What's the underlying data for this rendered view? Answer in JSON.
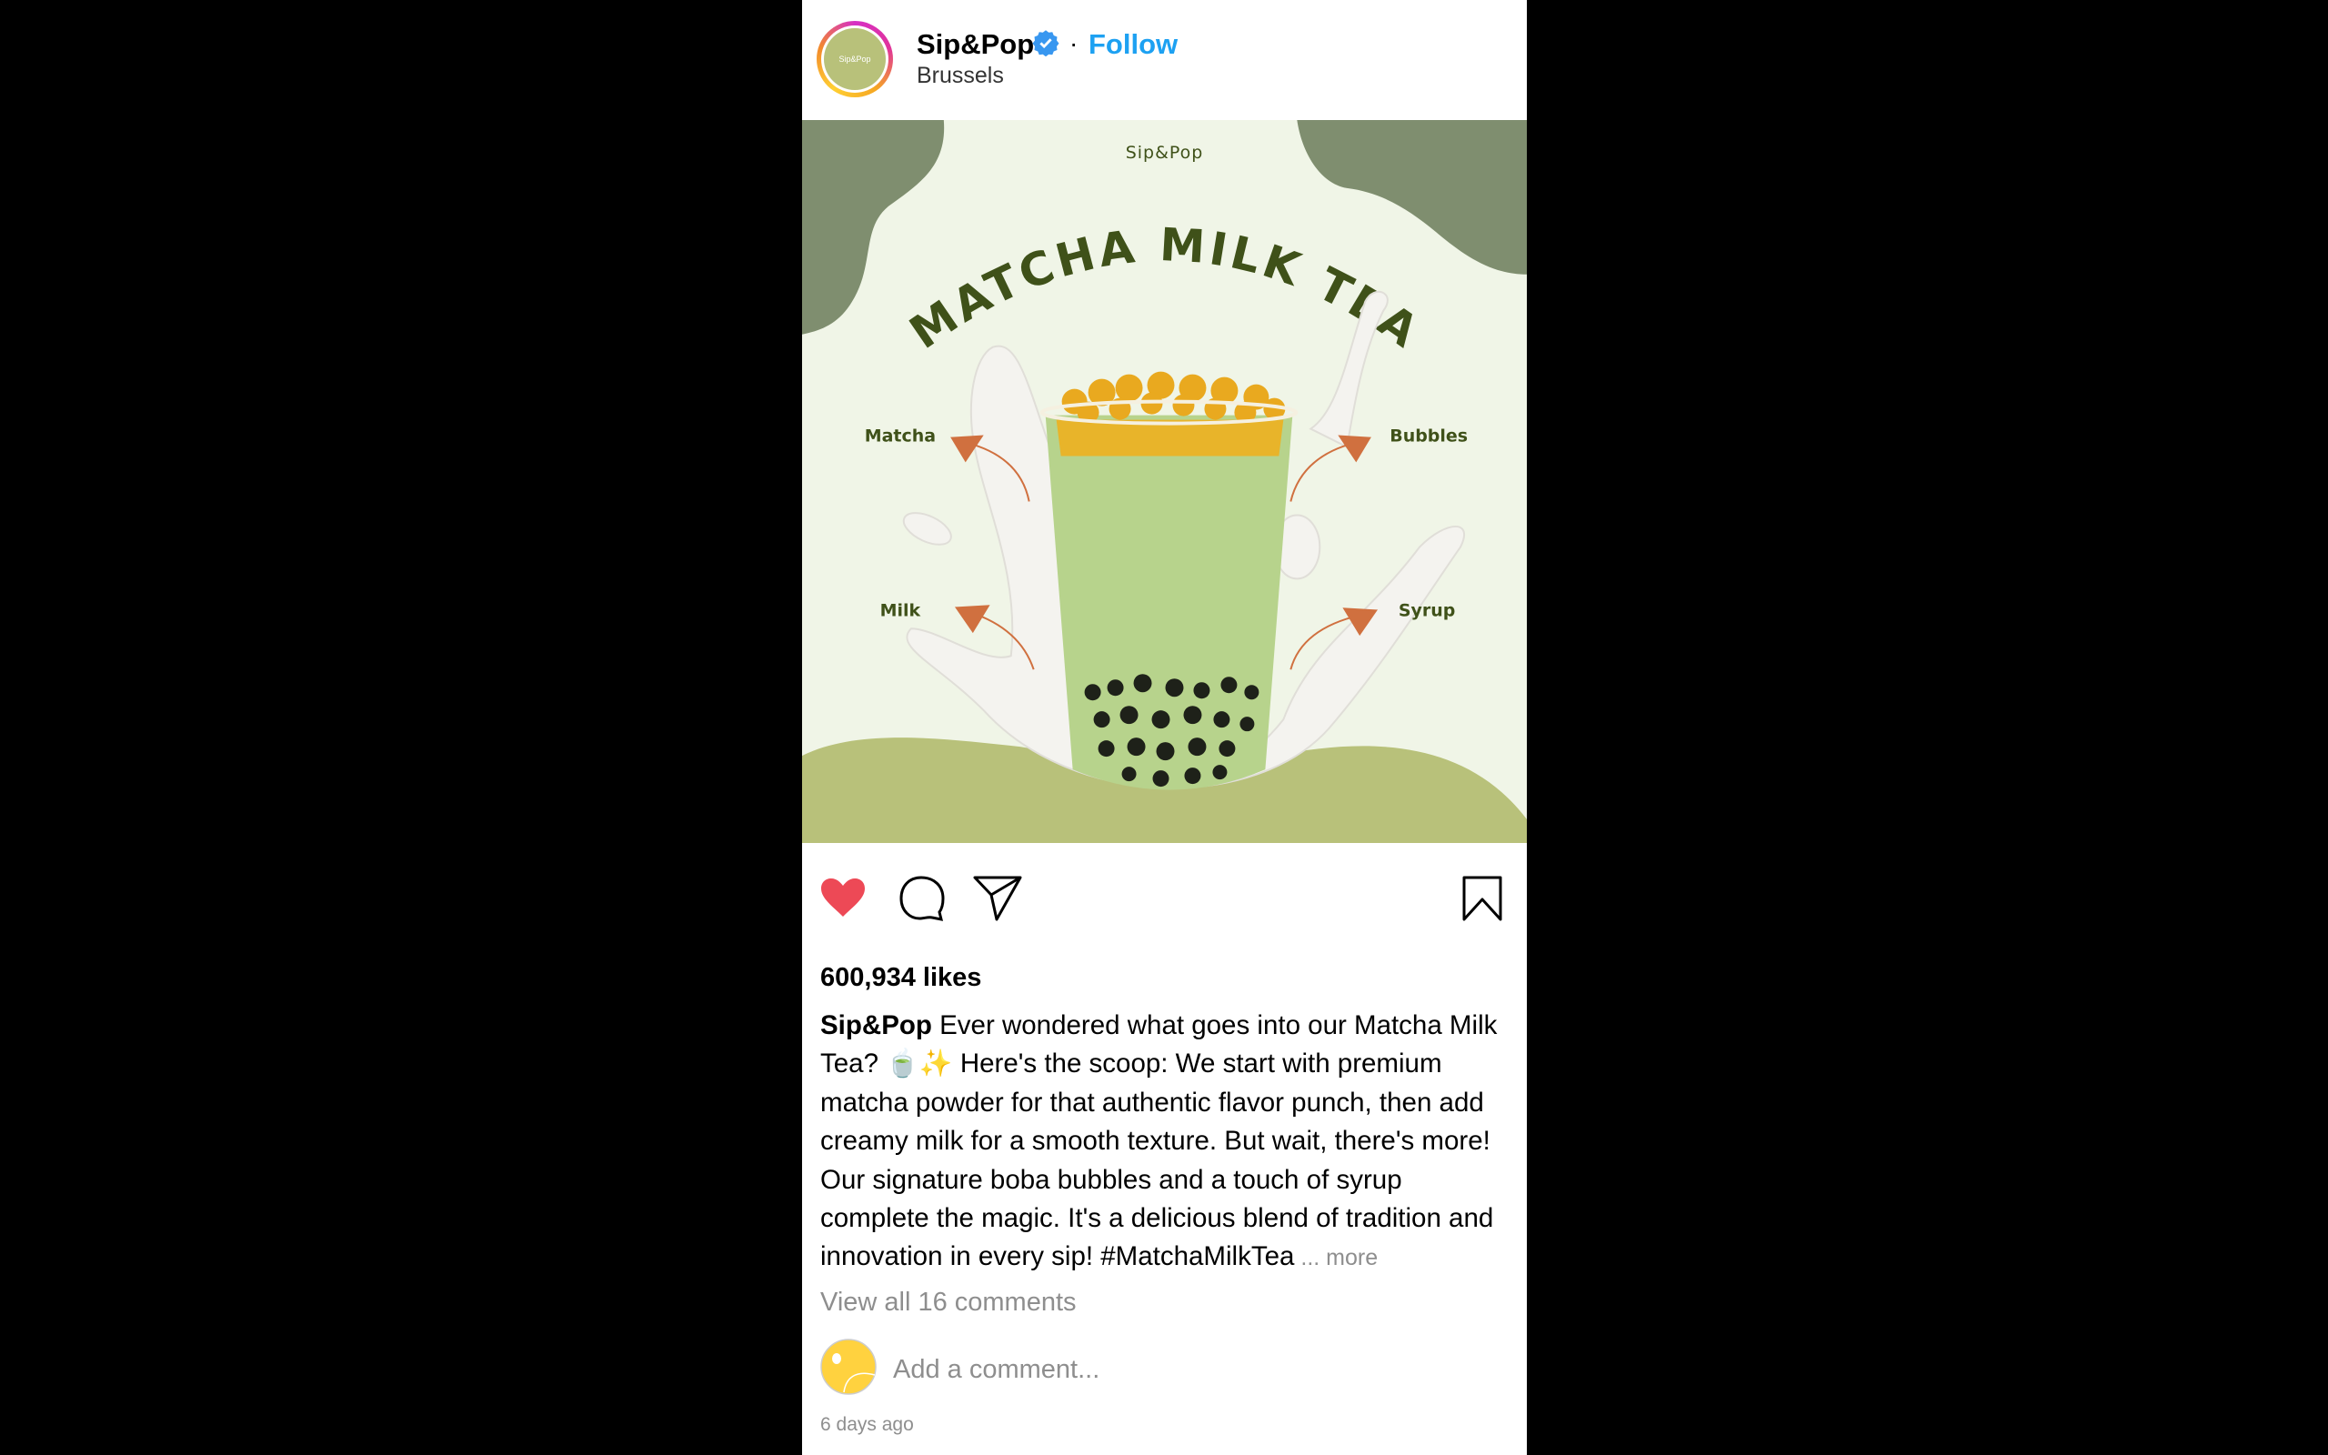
{
  "post": {
    "username": "Sip&Pop",
    "avatar_text": "Sip&Pop",
    "separator": "·",
    "follow_label": "Follow",
    "location": "Brussels",
    "image": {
      "brand": "Sip&Pop",
      "title": "MATCHA MILK TEA",
      "labels": [
        "Matcha",
        "Bubbles",
        "Milk",
        "Syrup"
      ]
    },
    "likes": "600,934 likes",
    "caption_user": "Sip&Pop",
    "caption_text": " Ever wondered what goes into our Matcha Milk Tea? 🍵✨ Here's the scoop: We start with premium matcha powder for that authentic flavor punch, then add creamy milk for a smooth texture. But wait, there's more! Our signature boba bubbles and a touch of syrup complete the magic. It's a delicious blend of tradition and innovation in every sip! #MatchaMilkTea",
    "more_label": " ... more",
    "view_comments": "View all 16 comments",
    "comment_placeholder": "Add a comment...",
    "timestamp": "6 days ago"
  },
  "colors": {
    "like": "#ed4956",
    "follow": "#1da1f2",
    "image_bg": "#f0f5e7",
    "blob_dark": "#7f8e6f",
    "hill": "#b8c17a",
    "title": "#3f5119",
    "arrow": "#d0703f"
  }
}
